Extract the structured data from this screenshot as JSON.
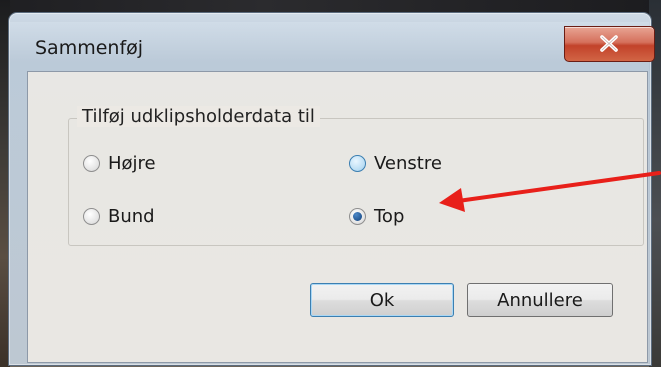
{
  "window": {
    "title": "Sammenføj",
    "close_icon": "close-icon"
  },
  "group": {
    "legend": "Tilføj udklipsholderdata til",
    "options": [
      {
        "label": "Højre",
        "checked": false
      },
      {
        "label": "Venstre",
        "checked": false
      },
      {
        "label": "Bund",
        "checked": false
      },
      {
        "label": "Top",
        "checked": true
      }
    ]
  },
  "buttons": {
    "ok_label": "Ok",
    "cancel_label": "Annullere"
  },
  "annotation": {
    "arrow_color": "#e8201a",
    "icon": "arrow-icon"
  }
}
